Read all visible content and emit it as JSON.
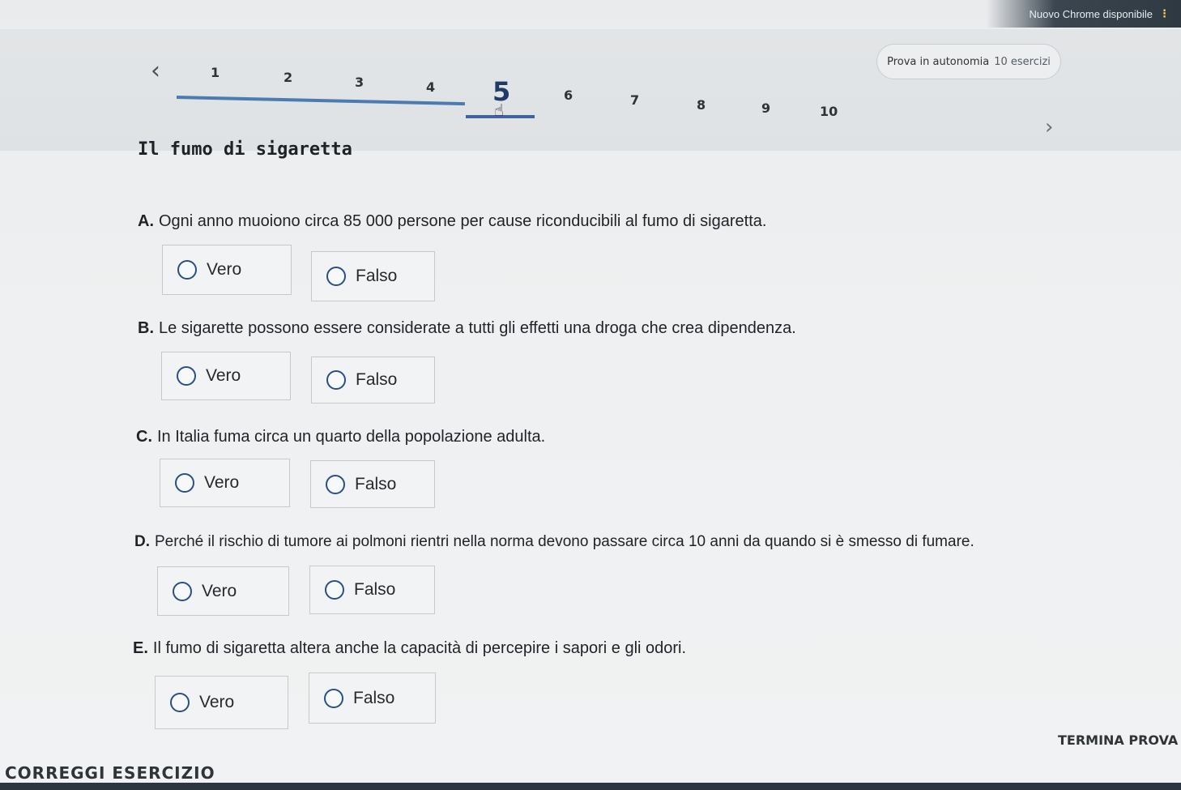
{
  "browser": {
    "update_notice": "Nuovo Chrome disponibile",
    "menu_icon": "kebab-icon"
  },
  "header": {
    "exam_label": "Prova in autonomia",
    "exam_count": "10 esercizi",
    "pages": [
      "1",
      "2",
      "3",
      "4",
      "5",
      "6",
      "7",
      "8",
      "9",
      "10"
    ],
    "current_page": "5",
    "prev_icon": "chevron-left-icon",
    "next_icon": "chevron-right-icon"
  },
  "exercise": {
    "title": "Il fumo di sigaretta",
    "questions": [
      {
        "letter": "A.",
        "text": "Ogni anno muoiono circa 85 000 persone per cause riconducibili al fumo di sigaretta.",
        "true_label": "Vero",
        "false_label": "Falso"
      },
      {
        "letter": "B.",
        "text": "Le sigarette possono essere considerate a tutti gli effetti una droga che crea dipendenza.",
        "true_label": "Vero",
        "false_label": "Falso"
      },
      {
        "letter": "C.",
        "text": "In Italia fuma circa un quarto della popolazione adulta.",
        "true_label": "Vero",
        "false_label": "Falso"
      },
      {
        "letter": "D.",
        "text": "Perché il rischio di tumore ai polmoni rientri nella norma devono passare circa 10 anni da quando si è smesso di fumare.",
        "true_label": "Vero",
        "false_label": "Falso"
      },
      {
        "letter": "E.",
        "text": "Il fumo di sigaretta altera anche la capacità di percepire i sapori e gli odori.",
        "true_label": "Vero",
        "false_label": "Falso"
      }
    ]
  },
  "footer": {
    "correct_button": "CORREGGI ESERCIZIO",
    "finish_button": "TERMINA PROVA"
  }
}
